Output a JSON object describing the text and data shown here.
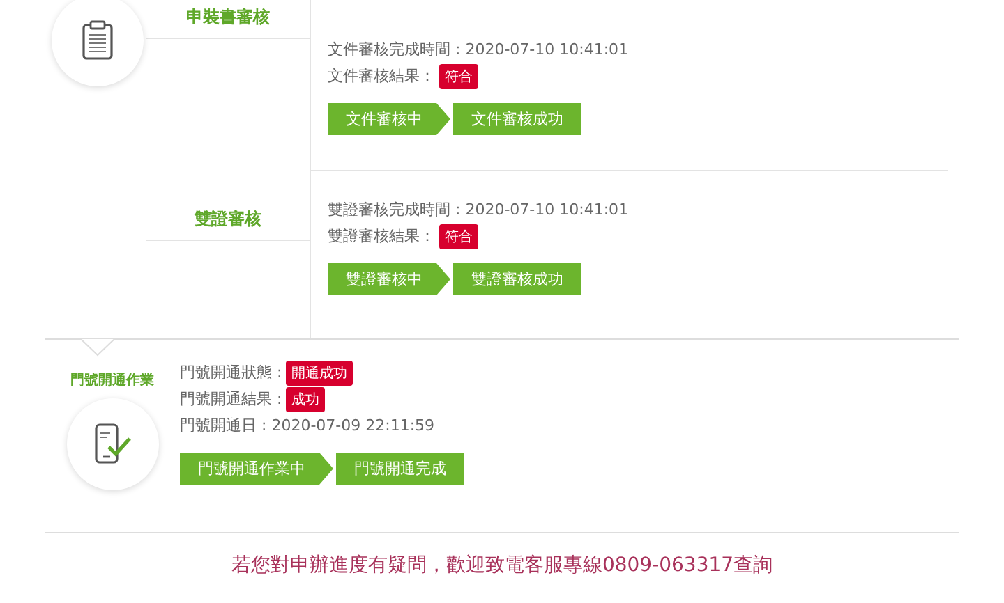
{
  "sections": [
    {
      "steps": [
        {
          "title": "申裝書審核",
          "details": [
            {
              "kind": "text",
              "label": "文件審核完成時間 : 2020-07-10 10:41:01"
            },
            {
              "kind": "badge",
              "label": "文件審核結果：",
              "value": "符合"
            }
          ],
          "progress": [
            "文件審核中",
            "文件審核成功"
          ]
        },
        {
          "title": "雙證審核",
          "details": [
            {
              "kind": "text",
              "label": "雙證審核完成時間 : 2020-07-10 10:41:01"
            },
            {
              "kind": "badge",
              "label": "雙證審核結果：",
              "value": "符合"
            }
          ],
          "progress": [
            "雙證審核中",
            "雙證審核成功"
          ]
        }
      ]
    },
    {
      "steps": [
        {
          "title": "門號開通作業",
          "details": [
            {
              "kind": "badge",
              "label": "門號開通狀態 :",
              "value": "開通成功"
            },
            {
              "kind": "badge",
              "label": "門號開通結果 :",
              "value": "成功"
            },
            {
              "kind": "text",
              "label": "門號開通日 : 2020-07-09 22:11:59"
            }
          ],
          "progress": [
            "門號開通作業中",
            "門號開通完成"
          ]
        }
      ]
    }
  ],
  "footer": "若您對申辦進度有疑問，歡迎致電客服專線0809-063317查詢"
}
